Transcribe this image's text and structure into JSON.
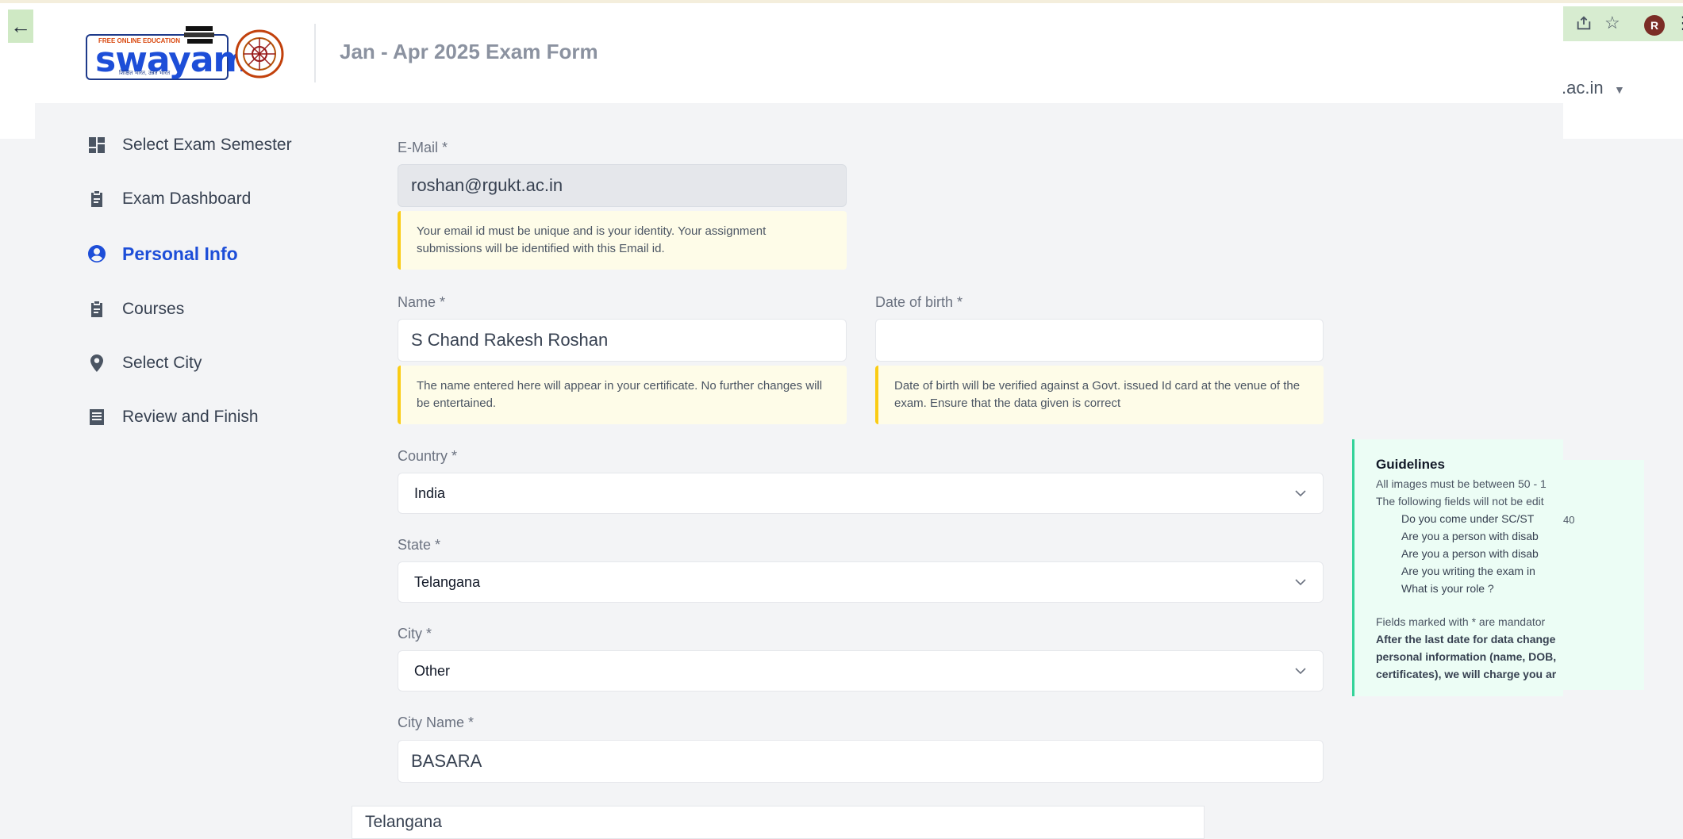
{
  "header": {
    "title": "Jan - Apr 2025 Exam Form",
    "logo": {
      "wordmark": "swayam",
      "small_text": "FREE ONLINE EDUCATION",
      "tagline": "शिक्षित भारत, उन्नत भारत"
    }
  },
  "browser": {
    "profile_initial": "R",
    "account_email_fragment": ".ac.in",
    "icons": [
      "back-arrow-icon",
      "share-icon",
      "star-icon",
      "menu-dots-icon"
    ]
  },
  "sidebar": {
    "items": [
      {
        "label": "Select Exam Semester",
        "icon": "dashboard-icon"
      },
      {
        "label": "Exam Dashboard",
        "icon": "clipboard-icon"
      },
      {
        "label": "Personal Info",
        "icon": "user-circle-icon",
        "active": true
      },
      {
        "label": "Courses",
        "icon": "clipboard-icon"
      },
      {
        "label": "Select City",
        "icon": "location-pin-icon"
      },
      {
        "label": "Review and Finish",
        "icon": "document-icon"
      }
    ]
  },
  "form": {
    "email": {
      "label": "E-Mail *",
      "value": "roshan@rgukt.ac.in",
      "note": "Your email id must be unique and is your identity. Your assignment submissions will be identified with this Email id."
    },
    "name": {
      "label": "Name *",
      "value": "S Chand Rakesh Roshan",
      "note": "The name entered here will appear in your certificate. No further changes will be entertained."
    },
    "dob": {
      "label": "Date of birth *",
      "value": "",
      "note": "Date of birth will be verified against a Govt. issued Id card at the venue of the exam. Ensure that the data given is correct"
    },
    "country": {
      "label": "Country *",
      "value": "India"
    },
    "state": {
      "label": "State *",
      "value": "Telangana"
    },
    "city": {
      "label": "City *",
      "value": "Other"
    },
    "city_name": {
      "label": "City Name *",
      "value": "BASARA"
    },
    "bottom_value": "Telangana"
  },
  "guidelines": {
    "title": "Guidelines",
    "line1": "All images must be between 50 - 1",
    "line2": "The following fields will not be edit",
    "bullets": [
      "Do you come under SC/ST",
      "Are you a person with disab",
      "Are you a person with disab",
      "Are you writing the exam in",
      "What is your role ?"
    ],
    "overlap_text": "40",
    "mandatory_note": "Fields marked with * are mandator",
    "bold_lines": [
      "After the last date for data change",
      "personal information (name, DOB,",
      "certificates), we will charge you ar"
    ]
  },
  "colors": {
    "accent": "#1d4ed8",
    "note_border": "#facc15",
    "guide_border": "#34d399"
  }
}
